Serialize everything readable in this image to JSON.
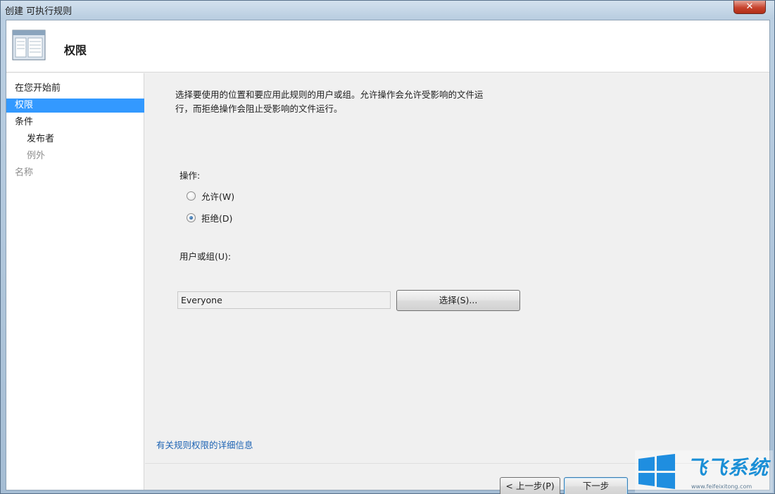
{
  "window": {
    "title": "创建 可执行规则",
    "close_label": "✕"
  },
  "header": {
    "title": "权限",
    "icon": "window-panel-icon"
  },
  "sidebar": {
    "items": [
      {
        "label": "在您开始前",
        "state": "normal"
      },
      {
        "label": "权限",
        "state": "selected"
      },
      {
        "label": "条件",
        "state": "normal"
      },
      {
        "label": "发布者",
        "state": "sub"
      },
      {
        "label": "例外",
        "state": "sub-disabled"
      },
      {
        "label": "名称",
        "state": "disabled"
      }
    ]
  },
  "main": {
    "description_line1": "选择要使用的位置和要应用此规则的用户或组。允许操作会允许受影响的文件运",
    "description_line2": "行，而拒绝操作会阻止受影响的文件运行。",
    "action_label": "操作:",
    "action_options": [
      {
        "label": "允许(W)",
        "checked": false
      },
      {
        "label": "拒绝(D)",
        "checked": true
      }
    ],
    "user_label": "用户或组(U):",
    "user_value": "Everyone",
    "select_button": "选择(S)...",
    "link": "有关规则权限的详细信息"
  },
  "footer": {
    "back_button": "< 上一步(P)",
    "next_button": "下一步"
  },
  "watermark": {
    "text": "飞飞系统",
    "sub": "www.feifeixitong.com"
  },
  "colors": {
    "selection": "#3399ff",
    "link": "#1e64b4",
    "brand": "#1b8fd6"
  }
}
